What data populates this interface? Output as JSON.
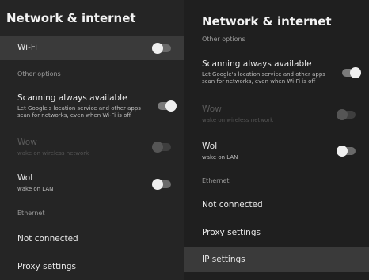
{
  "left": {
    "title": "Network & internet",
    "wifi_label": "Wi-Fi",
    "other_options_header": "Other options",
    "scanning_label": "Scanning always available",
    "scanning_desc_line1": "Let Google's location service and other apps",
    "scanning_desc_line2": "scan for networks, even when Wi-Fi is off",
    "wow_label": "Wow",
    "wow_desc": "wake on wireless network",
    "wol_label": "Wol",
    "wol_desc": "wake on LAN",
    "ethernet_header": "Ethernet",
    "not_connected_label": "Not connected",
    "proxy_label": "Proxy settings"
  },
  "right": {
    "title": "Network & internet",
    "other_options_header": "Other options",
    "scanning_label": "Scanning always available",
    "scanning_desc_line1": "Let Google's location service and other apps",
    "scanning_desc_line2": "scan for networks, even when Wi-Fi is off",
    "wow_label": "Wow",
    "wow_desc": "wake on wireless network",
    "wol_label": "Wol",
    "wol_desc": "wake on LAN",
    "ethernet_header": "Ethernet",
    "not_connected_label": "Not connected",
    "proxy_label": "Proxy settings",
    "ip_label": "IP settings"
  },
  "toggles": {
    "wifi": "off",
    "scanning": "on",
    "wow": "disabled",
    "wol": "off"
  },
  "colors": {
    "background": "#1b1b1b",
    "focus_highlight": "#3a3a3a",
    "disabled_text": "#5b5b5b"
  }
}
